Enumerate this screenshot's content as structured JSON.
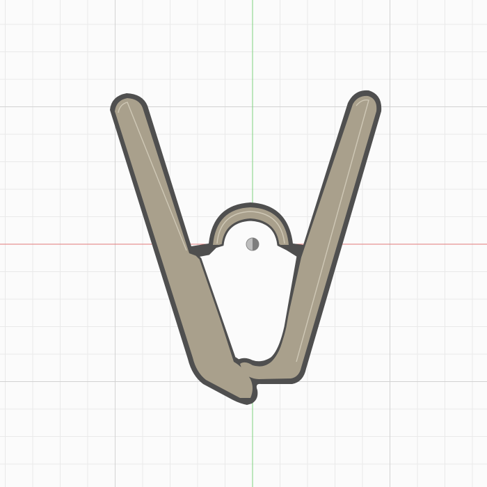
{
  "viewport": {
    "name": "cad-3d-viewport",
    "background": "#fbfbfb",
    "grid": {
      "visible": true,
      "minor_color": "#e9e9e9",
      "major_color": "#d2d2d2"
    },
    "axes": {
      "x_axis_color": "#e07a7a",
      "y_axis_color": "#7fd17f"
    },
    "origin_marker": {
      "icon": "origin-point-icon"
    }
  },
  "model": {
    "name": "clip-body",
    "face_color": "#a9a08c",
    "edge_color": "#4f4f4f",
    "highlight_color": "#cfc8b6"
  }
}
